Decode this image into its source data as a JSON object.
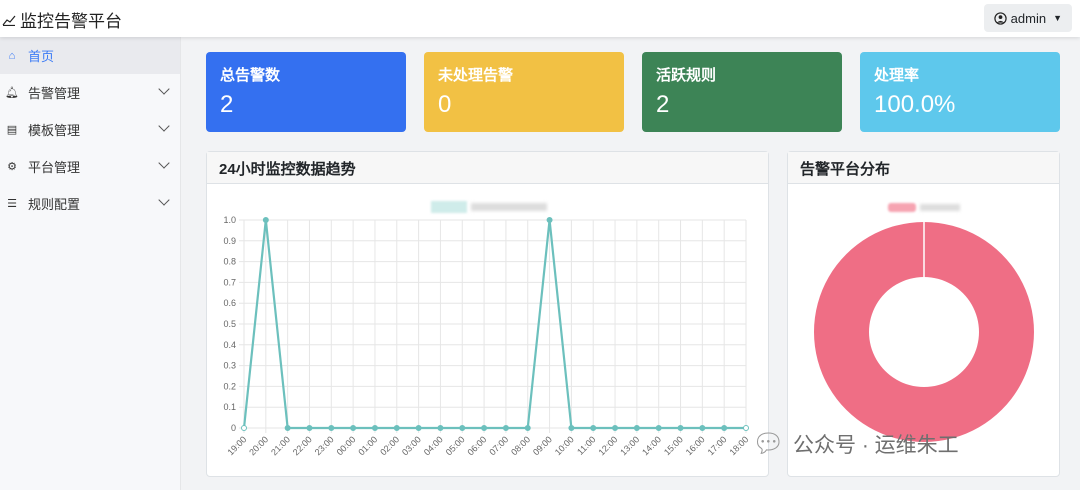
{
  "header": {
    "title": "监控告警平台",
    "user": "admin"
  },
  "sidebar": {
    "items": [
      {
        "label": "首页",
        "icon": "home-icon",
        "active": true
      },
      {
        "label": "告警管理",
        "icon": "bell-icon"
      },
      {
        "label": "模板管理",
        "icon": "document-icon"
      },
      {
        "label": "平台管理",
        "icon": "gear-icon"
      },
      {
        "label": "规则配置",
        "icon": "list-icon"
      }
    ]
  },
  "cards": [
    {
      "title": "总告警数",
      "value": "2",
      "color": "#3470f0"
    },
    {
      "title": "未处理告警",
      "value": "0",
      "color": "#f2c144"
    },
    {
      "title": "活跃规则",
      "value": "2",
      "color": "#3d8456"
    },
    {
      "title": "处理率",
      "value": "100.0%",
      "color": "#5ec8ec"
    }
  ],
  "trend": {
    "title": "24小时监控数据趋势"
  },
  "distribution": {
    "title": "告警平台分布"
  },
  "watermark": "公众号 · 运维朱工",
  "chart_data": [
    {
      "type": "line",
      "x": [
        "19:00",
        "20:00",
        "21:00",
        "22:00",
        "23:00",
        "00:00",
        "01:00",
        "02:00",
        "03:00",
        "04:00",
        "05:00",
        "06:00",
        "07:00",
        "08:00",
        "09:00",
        "10:00",
        "11:00",
        "12:00",
        "13:00",
        "14:00",
        "15:00",
        "16:00",
        "17:00",
        "18:00"
      ],
      "values": [
        0,
        1,
        0,
        0,
        0,
        0,
        0,
        0,
        0,
        0,
        0,
        0,
        0,
        0,
        1,
        0,
        0,
        0,
        0,
        0,
        0,
        0,
        0,
        0
      ],
      "yticks": [
        "0",
        "0.1",
        "0.2",
        "0.3",
        "0.4",
        "0.5",
        "0.6",
        "0.7",
        "0.8",
        "0.9",
        "1.0"
      ],
      "ylim": [
        0,
        1
      ],
      "grid": true,
      "color": "#6cc0bd"
    },
    {
      "type": "pie",
      "donut": true,
      "values": [
        2
      ],
      "color": "#ef6e85"
    }
  ]
}
